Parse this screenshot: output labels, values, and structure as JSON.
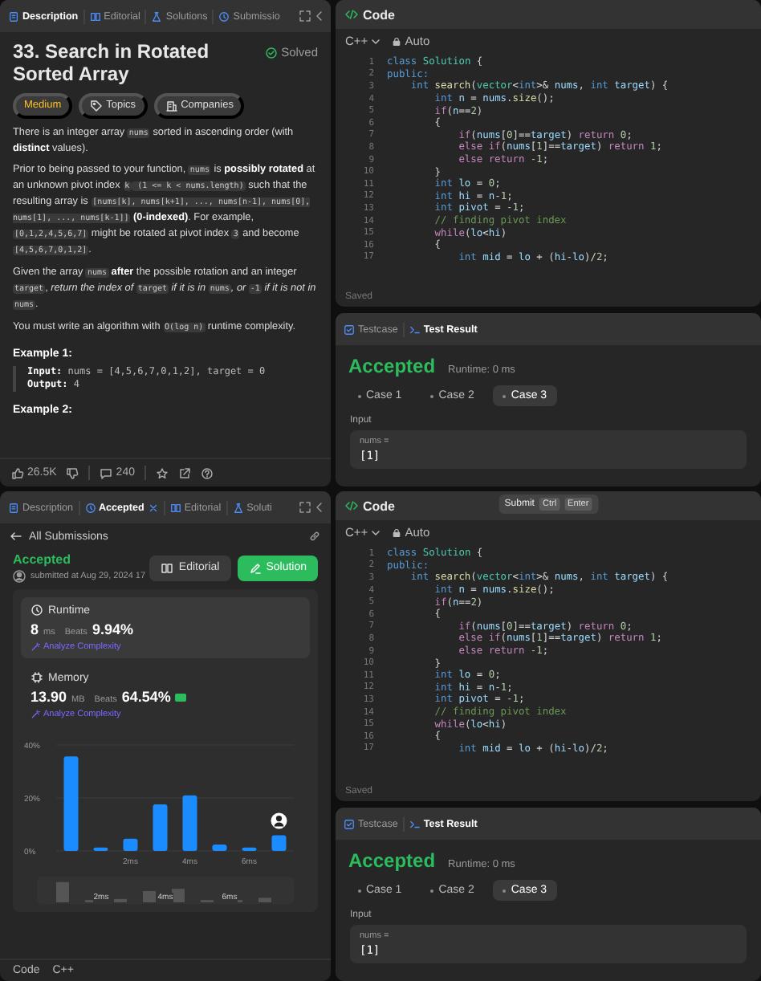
{
  "description_panel": {
    "tabs": [
      {
        "label": "Description",
        "selected": true,
        "kind": "description"
      },
      {
        "label": "Editorial",
        "selected": false,
        "kind": "editorial"
      },
      {
        "label": "Solutions",
        "selected": false,
        "kind": "solutions"
      },
      {
        "label": "Submissio",
        "selected": false,
        "kind": "submissions"
      }
    ],
    "title": "33. Search in Rotated Sorted Array",
    "status": "Solved",
    "tags": [
      {
        "label": "Medium",
        "kind": "difficulty"
      },
      {
        "label": "Topics",
        "kind": "topics"
      },
      {
        "label": "Companies",
        "kind": "companies"
      }
    ],
    "paragraphs": [
      [
        {
          "t": "There is an integer array "
        },
        {
          "t": "nums",
          "kind": "c"
        },
        {
          "t": " sorted in ascending order (with "
        },
        {
          "t": "distinct",
          "kind": "b"
        },
        {
          "t": " values)."
        }
      ],
      [
        {
          "t": "Prior to being passed to your function, "
        },
        {
          "t": "nums",
          "kind": "c"
        },
        {
          "t": " is "
        },
        {
          "t": "possibly rotated",
          "kind": "b"
        },
        {
          "t": " at an unknown pivot index "
        },
        {
          "t": "k",
          "kind": "c"
        },
        {
          "t": " (1 <= k < nums.length)",
          "kind": "c"
        },
        {
          "t": " such that the resulting array is "
        },
        {
          "t": "[nums[k], nums[k+1], ..., nums[n-1], nums[0], nums[1], ..., nums[k-1]]",
          "kind": "c"
        },
        {
          "t": " (0-indexed)",
          "kind": "b"
        },
        {
          "t": ". For example, "
        },
        {
          "t": "[0,1,2,4,5,6,7]",
          "kind": "c"
        },
        {
          "t": " might be rotated at pivot index "
        },
        {
          "t": "3",
          "kind": "c"
        },
        {
          "t": " and become "
        },
        {
          "t": "[4,5,6,7,0,1,2]",
          "kind": "c"
        },
        {
          "t": "."
        }
      ],
      [
        {
          "t": "Given the array "
        },
        {
          "t": "nums",
          "kind": "c"
        },
        {
          "t": " after",
          "kind": "b"
        },
        {
          "t": " the possible rotation and an integer "
        },
        {
          "t": "target",
          "kind": "c"
        },
        {
          "t": ", "
        },
        {
          "t": "return the index of ",
          "kind": "i"
        },
        {
          "t": "target",
          "kind": "c"
        },
        {
          "t": " if it is in ",
          "kind": "i"
        },
        {
          "t": "nums",
          "kind": "c"
        },
        {
          "t": ", or ",
          "kind": "i"
        },
        {
          "t": "-1",
          "kind": "c"
        },
        {
          "t": " if it is not in ",
          "kind": "i"
        },
        {
          "t": "nums",
          "kind": "c"
        },
        {
          "t": "."
        }
      ],
      [
        {
          "t": "You must write an algorithm with "
        },
        {
          "t": "O(log n)",
          "kind": "c"
        },
        {
          "t": " runtime complexity."
        }
      ]
    ],
    "examples": [
      {
        "title": "Example 1:",
        "lines": [
          [
            {
              "t": "Input:",
              "kind": "b"
            },
            {
              "t": " nums = [4,5,6,7,0,1,2], target = 0"
            }
          ],
          [
            {
              "t": "Output:",
              "kind": "b"
            },
            {
              "t": " 4"
            }
          ]
        ]
      },
      {
        "title": "Example 2:"
      }
    ],
    "footer": {
      "likes": "26.5K",
      "comments": "240"
    }
  },
  "editor_top": {
    "title": "Code",
    "language": "C++",
    "mode": "Auto",
    "status": "Saved",
    "lines": [
      {
        "n": "1",
        "seg": [
          {
            "t": "class",
            "kind": "kw"
          },
          {
            "t": " Solution",
            "kind": "ty"
          },
          {
            "t": " {"
          }
        ]
      },
      {
        "n": "2",
        "seg": [
          {
            "t": "public:",
            "kind": "kw"
          }
        ]
      },
      {
        "n": "3",
        "seg": [
          {
            "t": "    int",
            "kind": "kw"
          },
          {
            "t": " search",
            "kind": "fn"
          },
          {
            "t": "("
          },
          {
            "t": "vector",
            "kind": "ty"
          },
          {
            "t": "<"
          },
          {
            "t": "int",
            "kind": "kw"
          },
          {
            "t": ">& "
          },
          {
            "t": "nums",
            "kind": "var"
          },
          {
            "t": ", "
          },
          {
            "t": "int",
            "kind": "kw"
          },
          {
            "t": " target",
            "kind": "var"
          },
          {
            "t": ") {"
          }
        ]
      },
      {
        "n": "4",
        "seg": [
          {
            "t": "        int",
            "kind": "kw"
          },
          {
            "t": " n",
            "kind": "var"
          },
          {
            "t": " = "
          },
          {
            "t": "nums",
            "kind": "var"
          },
          {
            "t": "."
          },
          {
            "t": "size",
            "kind": "fn"
          },
          {
            "t": "();"
          }
        ]
      },
      {
        "n": "5",
        "seg": [
          {
            "t": "        if",
            "kind": "ctl"
          },
          {
            "t": "("
          },
          {
            "t": "n",
            "kind": "var"
          },
          {
            "t": "=="
          },
          {
            "t": "2",
            "kind": "num"
          },
          {
            "t": ")"
          }
        ]
      },
      {
        "n": "6",
        "seg": [
          {
            "t": "        {"
          }
        ]
      },
      {
        "n": "7",
        "seg": [
          {
            "t": "            if",
            "kind": "ctl"
          },
          {
            "t": "("
          },
          {
            "t": "nums",
            "kind": "var"
          },
          {
            "t": "["
          },
          {
            "t": "0",
            "kind": "num"
          },
          {
            "t": "]=="
          },
          {
            "t": "target",
            "kind": "var"
          },
          {
            "t": ") "
          },
          {
            "t": "return ",
            "kind": "ctl"
          },
          {
            "t": "0",
            "kind": "num"
          },
          {
            "t": ";"
          }
        ]
      },
      {
        "n": "8",
        "seg": [
          {
            "t": "            else if",
            "kind": "ctl"
          },
          {
            "t": "("
          },
          {
            "t": "nums",
            "kind": "var"
          },
          {
            "t": "["
          },
          {
            "t": "1",
            "kind": "num"
          },
          {
            "t": "]=="
          },
          {
            "t": "target",
            "kind": "var"
          },
          {
            "t": ") "
          },
          {
            "t": "return ",
            "kind": "ctl"
          },
          {
            "t": "1",
            "kind": "num"
          },
          {
            "t": ";"
          }
        ]
      },
      {
        "n": "9",
        "seg": [
          {
            "t": "            else return ",
            "kind": "ctl"
          },
          {
            "t": "-1",
            "kind": "num"
          },
          {
            "t": ";"
          }
        ]
      },
      {
        "n": "10",
        "seg": [
          {
            "t": "        }"
          }
        ]
      },
      {
        "n": "11",
        "seg": [
          {
            "t": "        int",
            "kind": "kw"
          },
          {
            "t": " lo",
            "kind": "var"
          },
          {
            "t": " = "
          },
          {
            "t": "0",
            "kind": "num"
          },
          {
            "t": ";"
          }
        ]
      },
      {
        "n": "12",
        "seg": [
          {
            "t": "        int",
            "kind": "kw"
          },
          {
            "t": " hi",
            "kind": "var"
          },
          {
            "t": " = "
          },
          {
            "t": "n",
            "kind": "var"
          },
          {
            "t": "-"
          },
          {
            "t": "1",
            "kind": "num"
          },
          {
            "t": ";"
          }
        ]
      },
      {
        "n": "13",
        "seg": [
          {
            "t": "        int",
            "kind": "kw"
          },
          {
            "t": " pivot",
            "kind": "var"
          },
          {
            "t": " = "
          },
          {
            "t": "-1",
            "kind": "num"
          },
          {
            "t": ";"
          }
        ]
      },
      {
        "n": "14",
        "seg": [
          {
            "t": "        // finding pivot index",
            "kind": "cm"
          }
        ]
      },
      {
        "n": "15",
        "seg": [
          {
            "t": "        while",
            "kind": "ctl"
          },
          {
            "t": "("
          },
          {
            "t": "lo",
            "kind": "var"
          },
          {
            "t": "<"
          },
          {
            "t": "hi",
            "kind": "var"
          },
          {
            "t": ")"
          }
        ]
      },
      {
        "n": "16",
        "seg": [
          {
            "t": "        {"
          }
        ]
      },
      {
        "n": "17",
        "seg": [
          {
            "t": "            int",
            "kind": "kw"
          },
          {
            "t": " mid",
            "kind": "var"
          },
          {
            "t": " = "
          },
          {
            "t": "lo",
            "kind": "var"
          },
          {
            "t": " + ("
          },
          {
            "t": "hi",
            "kind": "var"
          },
          {
            "t": "-"
          },
          {
            "t": "lo",
            "kind": "var"
          },
          {
            "t": ")/"
          },
          {
            "t": "2",
            "kind": "num"
          },
          {
            "t": ";"
          }
        ]
      }
    ],
    "result": {
      "tabs": [
        {
          "label": "Testcase",
          "selected": false,
          "kind": "testcase"
        },
        {
          "label": "Test Result",
          "selected": true,
          "kind": "result"
        }
      ],
      "verdict": "Accepted",
      "runtime": "Runtime: 0 ms",
      "cases": [
        {
          "label": "Case 1",
          "selected": false
        },
        {
          "label": "Case 2",
          "selected": false
        },
        {
          "label": "Case 3",
          "selected": true
        }
      ],
      "input_label": "Input",
      "param": "nums =",
      "value": "[1]"
    }
  },
  "submission_panel": {
    "tabs": [
      {
        "label": "Description",
        "selected": false,
        "kind": "description",
        "closable": false
      },
      {
        "label": "Accepted",
        "selected": true,
        "kind": "accepted",
        "closable": true
      },
      {
        "label": "Editorial",
        "selected": false,
        "kind": "editorial",
        "closable": false
      },
      {
        "label": "Soluti",
        "selected": false,
        "kind": "solutions",
        "closable": false
      }
    ],
    "back": "All Submissions",
    "verdict": "Accepted",
    "submitted": "submitted at Aug 29, 2024 17",
    "buttons": [
      {
        "label": "Editorial",
        "kind": "secondary"
      },
      {
        "label": "Solution",
        "kind": "primary"
      }
    ],
    "stats": [
      {
        "kind": "runtime",
        "selected": true,
        "title": "Runtime",
        "value": "8",
        "unit": "ms",
        "beats_label": "Beats",
        "beats": "9.94%",
        "analyze": "Analyze Complexity"
      },
      {
        "kind": "memory",
        "selected": false,
        "title": "Memory",
        "value": "13.90",
        "unit": "MB",
        "beats_label": "Beats",
        "beats": "64.54%",
        "analyze": "Analyze Complexity"
      }
    ],
    "chart_data": {
      "type": "bar",
      "x": [
        0,
        1,
        2,
        3,
        4,
        5,
        6,
        7
      ],
      "xlim": [
        -0.5,
        7.5
      ],
      "values": [
        35.7,
        1.3,
        4.6,
        17.6,
        21,
        2.4,
        1.3,
        5.9
      ],
      "ylim": [
        0,
        40
      ],
      "yticks": [
        {
          "value": 0,
          "label": "0%"
        },
        {
          "value": 20,
          "label": "20%"
        },
        {
          "value": 40,
          "label": "40%"
        }
      ],
      "xticks": [
        {
          "value": 2,
          "label": "2ms"
        },
        {
          "value": 4,
          "label": "4ms"
        },
        {
          "value": 6,
          "label": "6ms"
        }
      ]
    },
    "overview_labels": [
      "2ms",
      "4ms",
      "6ms"
    ],
    "footer": {
      "tab": "Code",
      "language": "C++"
    }
  },
  "editor_bottom": {
    "title": "Code",
    "tooltip": {
      "label": "Submit",
      "keys": [
        "Ctrl",
        "Enter"
      ]
    },
    "language": "C++",
    "mode": "Auto",
    "status": "Saved",
    "lines": [
      {
        "n": "1",
        "seg": [
          {
            "t": "class",
            "kind": "kw"
          },
          {
            "t": " Solution",
            "kind": "ty"
          },
          {
            "t": " {"
          }
        ]
      },
      {
        "n": "2",
        "seg": [
          {
            "t": "public:",
            "kind": "kw"
          }
        ]
      },
      {
        "n": "3",
        "seg": [
          {
            "t": "    int",
            "kind": "kw"
          },
          {
            "t": " search",
            "kind": "fn"
          },
          {
            "t": "("
          },
          {
            "t": "vector",
            "kind": "ty"
          },
          {
            "t": "<"
          },
          {
            "t": "int",
            "kind": "kw"
          },
          {
            "t": ">& "
          },
          {
            "t": "nums",
            "kind": "var"
          },
          {
            "t": ", "
          },
          {
            "t": "int",
            "kind": "kw"
          },
          {
            "t": " target",
            "kind": "var"
          },
          {
            "t": ") {"
          }
        ]
      },
      {
        "n": "4",
        "seg": [
          {
            "t": "        int",
            "kind": "kw"
          },
          {
            "t": " n",
            "kind": "var"
          },
          {
            "t": " = "
          },
          {
            "t": "nums",
            "kind": "var"
          },
          {
            "t": "."
          },
          {
            "t": "size",
            "kind": "fn"
          },
          {
            "t": "();"
          }
        ]
      },
      {
        "n": "5",
        "seg": [
          {
            "t": "        if",
            "kind": "ctl"
          },
          {
            "t": "("
          },
          {
            "t": "n",
            "kind": "var"
          },
          {
            "t": "=="
          },
          {
            "t": "2",
            "kind": "num"
          },
          {
            "t": ")"
          }
        ]
      },
      {
        "n": "6",
        "seg": [
          {
            "t": "        {"
          }
        ]
      },
      {
        "n": "7",
        "seg": [
          {
            "t": "            if",
            "kind": "ctl"
          },
          {
            "t": "("
          },
          {
            "t": "nums",
            "kind": "var"
          },
          {
            "t": "["
          },
          {
            "t": "0",
            "kind": "num"
          },
          {
            "t": "]=="
          },
          {
            "t": "target",
            "kind": "var"
          },
          {
            "t": ") "
          },
          {
            "t": "return ",
            "kind": "ctl"
          },
          {
            "t": "0",
            "kind": "num"
          },
          {
            "t": ";"
          }
        ]
      },
      {
        "n": "8",
        "seg": [
          {
            "t": "            else if",
            "kind": "ctl"
          },
          {
            "t": "("
          },
          {
            "t": "nums",
            "kind": "var"
          },
          {
            "t": "["
          },
          {
            "t": "1",
            "kind": "num"
          },
          {
            "t": "]=="
          },
          {
            "t": "target",
            "kind": "var"
          },
          {
            "t": ") "
          },
          {
            "t": "return ",
            "kind": "ctl"
          },
          {
            "t": "1",
            "kind": "num"
          },
          {
            "t": ";"
          }
        ]
      },
      {
        "n": "9",
        "seg": [
          {
            "t": "            else return ",
            "kind": "ctl"
          },
          {
            "t": "-1",
            "kind": "num"
          },
          {
            "t": ";"
          }
        ]
      },
      {
        "n": "10",
        "seg": [
          {
            "t": "        }"
          }
        ]
      },
      {
        "n": "11",
        "seg": [
          {
            "t": "        int",
            "kind": "kw"
          },
          {
            "t": " lo",
            "kind": "var"
          },
          {
            "t": " = "
          },
          {
            "t": "0",
            "kind": "num"
          },
          {
            "t": ";"
          }
        ]
      },
      {
        "n": "12",
        "seg": [
          {
            "t": "        int",
            "kind": "kw"
          },
          {
            "t": " hi",
            "kind": "var"
          },
          {
            "t": " = "
          },
          {
            "t": "n",
            "kind": "var"
          },
          {
            "t": "-"
          },
          {
            "t": "1",
            "kind": "num"
          },
          {
            "t": ";"
          }
        ]
      },
      {
        "n": "13",
        "seg": [
          {
            "t": "        int",
            "kind": "kw"
          },
          {
            "t": " pivot",
            "kind": "var"
          },
          {
            "t": " = "
          },
          {
            "t": "-1",
            "kind": "num"
          },
          {
            "t": ";"
          }
        ]
      },
      {
        "n": "14",
        "seg": [
          {
            "t": "        // finding pivot index",
            "kind": "cm"
          }
        ]
      },
      {
        "n": "15",
        "seg": [
          {
            "t": "        while",
            "kind": "ctl"
          },
          {
            "t": "("
          },
          {
            "t": "lo",
            "kind": "var"
          },
          {
            "t": "<"
          },
          {
            "t": "hi",
            "kind": "var"
          },
          {
            "t": ")"
          }
        ]
      },
      {
        "n": "16",
        "seg": [
          {
            "t": "        {"
          }
        ]
      },
      {
        "n": "17",
        "seg": [
          {
            "t": "            int",
            "kind": "kw"
          },
          {
            "t": " mid",
            "kind": "var"
          },
          {
            "t": " = "
          },
          {
            "t": "lo",
            "kind": "var"
          },
          {
            "t": " + ("
          },
          {
            "t": "hi",
            "kind": "var"
          },
          {
            "t": "-"
          },
          {
            "t": "lo",
            "kind": "var"
          },
          {
            "t": ")/"
          },
          {
            "t": "2",
            "kind": "num"
          },
          {
            "t": ";"
          }
        ]
      }
    ],
    "result": {
      "tabs": [
        {
          "label": "Testcase",
          "selected": false,
          "kind": "testcase"
        },
        {
          "label": "Test Result",
          "selected": true,
          "kind": "result"
        }
      ],
      "verdict": "Accepted",
      "runtime": "Runtime: 0 ms",
      "cases": [
        {
          "label": "Case 1",
          "selected": false
        },
        {
          "label": "Case 2",
          "selected": false
        },
        {
          "label": "Case 3",
          "selected": true
        }
      ],
      "input_label": "Input",
      "param": "nums =",
      "value": "[1]"
    }
  }
}
